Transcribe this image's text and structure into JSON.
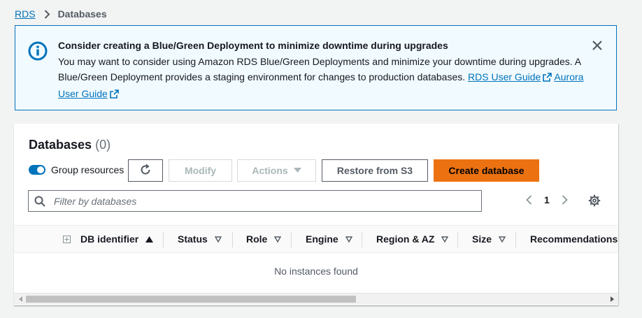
{
  "breadcrumb": {
    "root": "RDS",
    "current": "Databases"
  },
  "alert": {
    "title": "Consider creating a Blue/Green Deployment to minimize downtime during upgrades",
    "body": "You may want to consider using Amazon RDS Blue/Green Deployments and minimize your downtime during upgrades. A Blue/Green Deployment provides a staging environment for changes to production databases.",
    "link1": "RDS User Guide",
    "link2": "Aurora User Guide",
    "icon": "info-icon"
  },
  "panel": {
    "title": "Databases",
    "count": "(0)",
    "group_label": "Group resources",
    "group_enabled": true,
    "buttons": {
      "modify": "Modify",
      "actions": "Actions",
      "restore": "Restore from S3",
      "create": "Create database"
    },
    "filter_placeholder": "Filter by databases",
    "page": "1",
    "columns": [
      "DB identifier",
      "Status",
      "Role",
      "Engine",
      "Region & AZ",
      "Size",
      "Recommendations"
    ],
    "empty_text": "No instances found"
  },
  "colors": {
    "accent": "#0073bb",
    "primary_button": "#ec7211",
    "alert_bg": "#f1faff"
  }
}
